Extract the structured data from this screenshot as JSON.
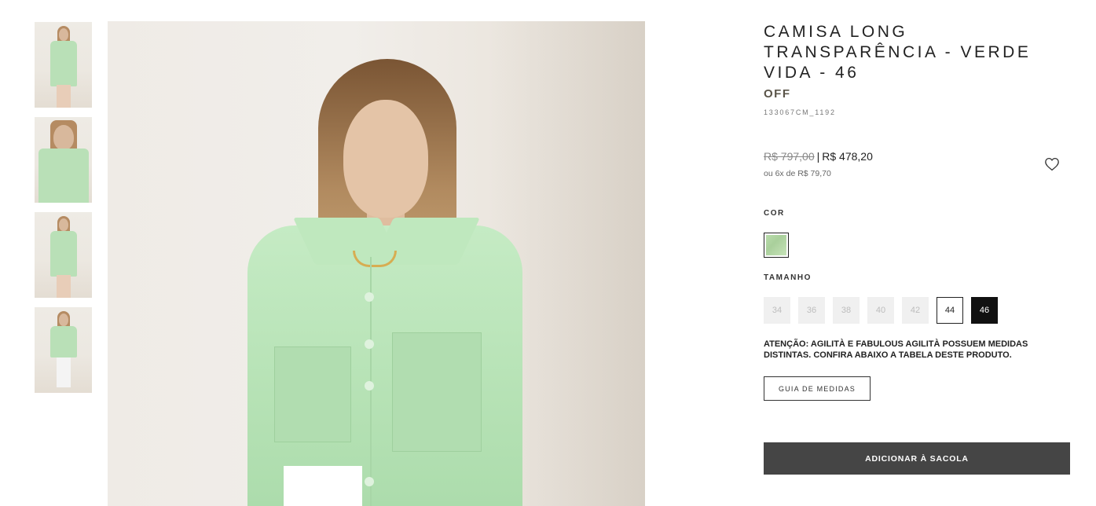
{
  "product": {
    "title": "CAMISA LONG TRANSPARÊNCIA - VERDE VIDA - 46",
    "badge": "OFF",
    "sku": "133067CM_1192",
    "price_old": "R$ 797,00",
    "price_separator": "|",
    "price_new": "R$ 478,20",
    "installments": "ou 6x de R$ 79,70"
  },
  "gallery": {
    "thumbnails": [
      "thumbnail-1",
      "thumbnail-2",
      "thumbnail-3",
      "thumbnail-4"
    ],
    "selected_index": 0
  },
  "color_section": {
    "label": "COR",
    "selected_color": "#b9dcab"
  },
  "size_section": {
    "label": "TAMANHO",
    "sizes": [
      {
        "label": "34",
        "state": "unavailable"
      },
      {
        "label": "36",
        "state": "unavailable"
      },
      {
        "label": "38",
        "state": "unavailable"
      },
      {
        "label": "40",
        "state": "unavailable"
      },
      {
        "label": "42",
        "state": "unavailable"
      },
      {
        "label": "44",
        "state": "available"
      },
      {
        "label": "46",
        "state": "selected"
      }
    ]
  },
  "notice": "ATENÇÃO: AGILITÀ E FABULOUS AGILITÀ POSSUEM MEDIDAS DISTINTAS. CONFIRA ABAIXO A TABELA DESTE PRODUTO.",
  "buttons": {
    "size_guide": "GUIA DE MEDIDAS",
    "add_to_bag": "ADICIONAR À SACOLA"
  },
  "icons": {
    "wishlist": "heart-icon"
  },
  "colors": {
    "add_button_bg": "#454545",
    "selected_size_bg": "#111111",
    "badge_text": "#5a5448"
  }
}
